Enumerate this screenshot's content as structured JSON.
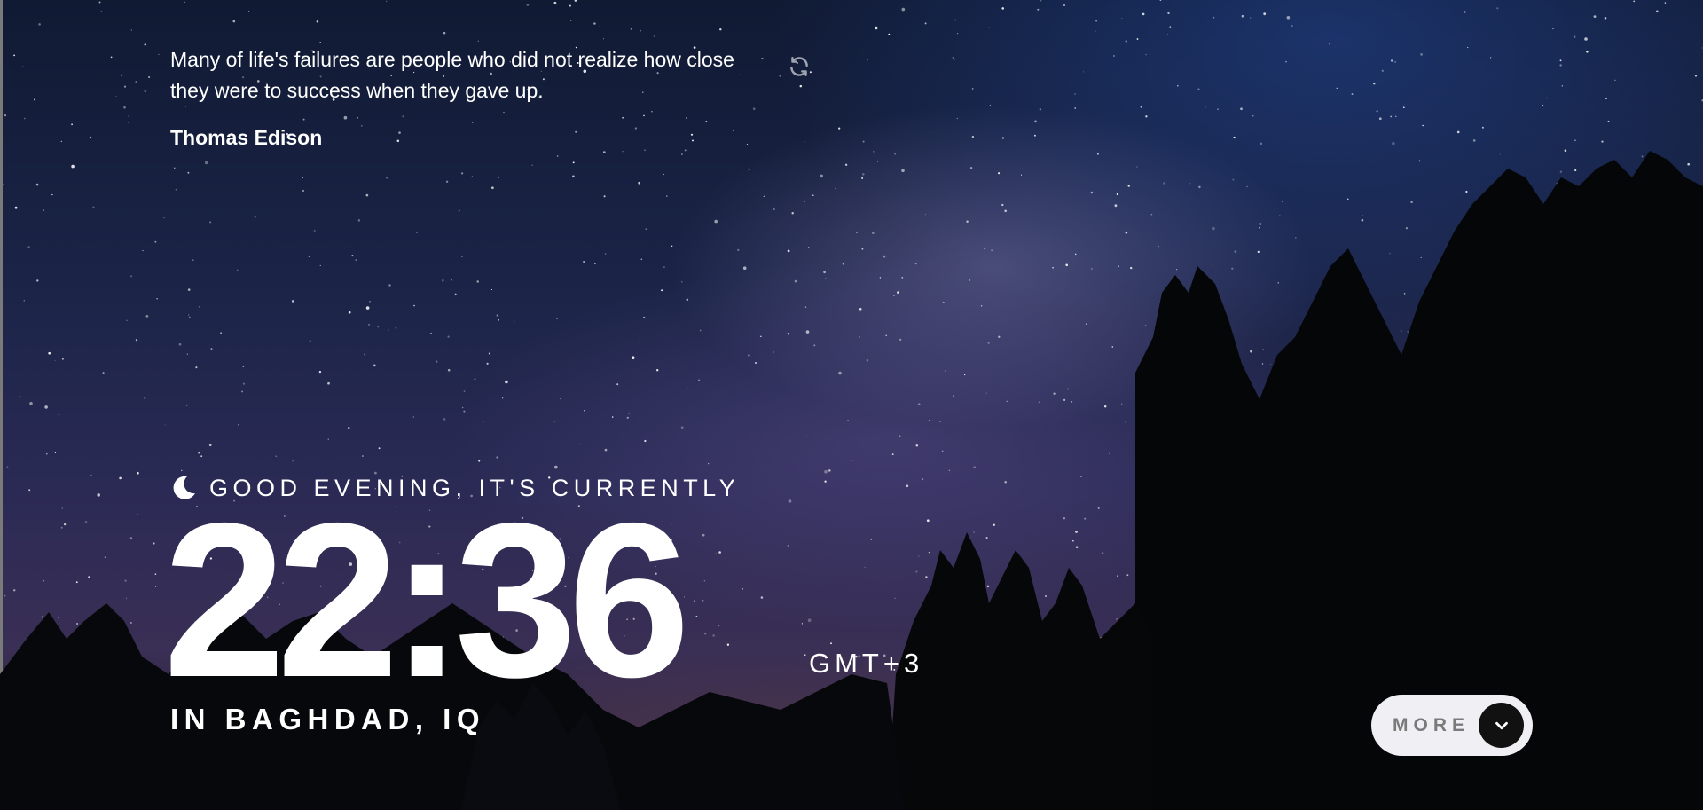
{
  "quote": {
    "text": "Many of life's failures are people who did not realize how close they were to success when they gave up.",
    "author": "Thomas Edison",
    "refresh_icon": "refresh-icon"
  },
  "clock": {
    "greeting": "GOOD EVENING, IT'S CURRENTLY",
    "greeting_icon": "moon-icon",
    "time": "22:36",
    "timezone": "GMT+3",
    "location": "IN BAGHDAD, IQ"
  },
  "more_button": {
    "label": "MORE",
    "icon": "chevron-down-icon"
  },
  "colors": {
    "button_bg": "#f0eff3",
    "button_label": "#7a7a7a",
    "button_icon_bg": "#111111",
    "text": "#ffffff"
  }
}
